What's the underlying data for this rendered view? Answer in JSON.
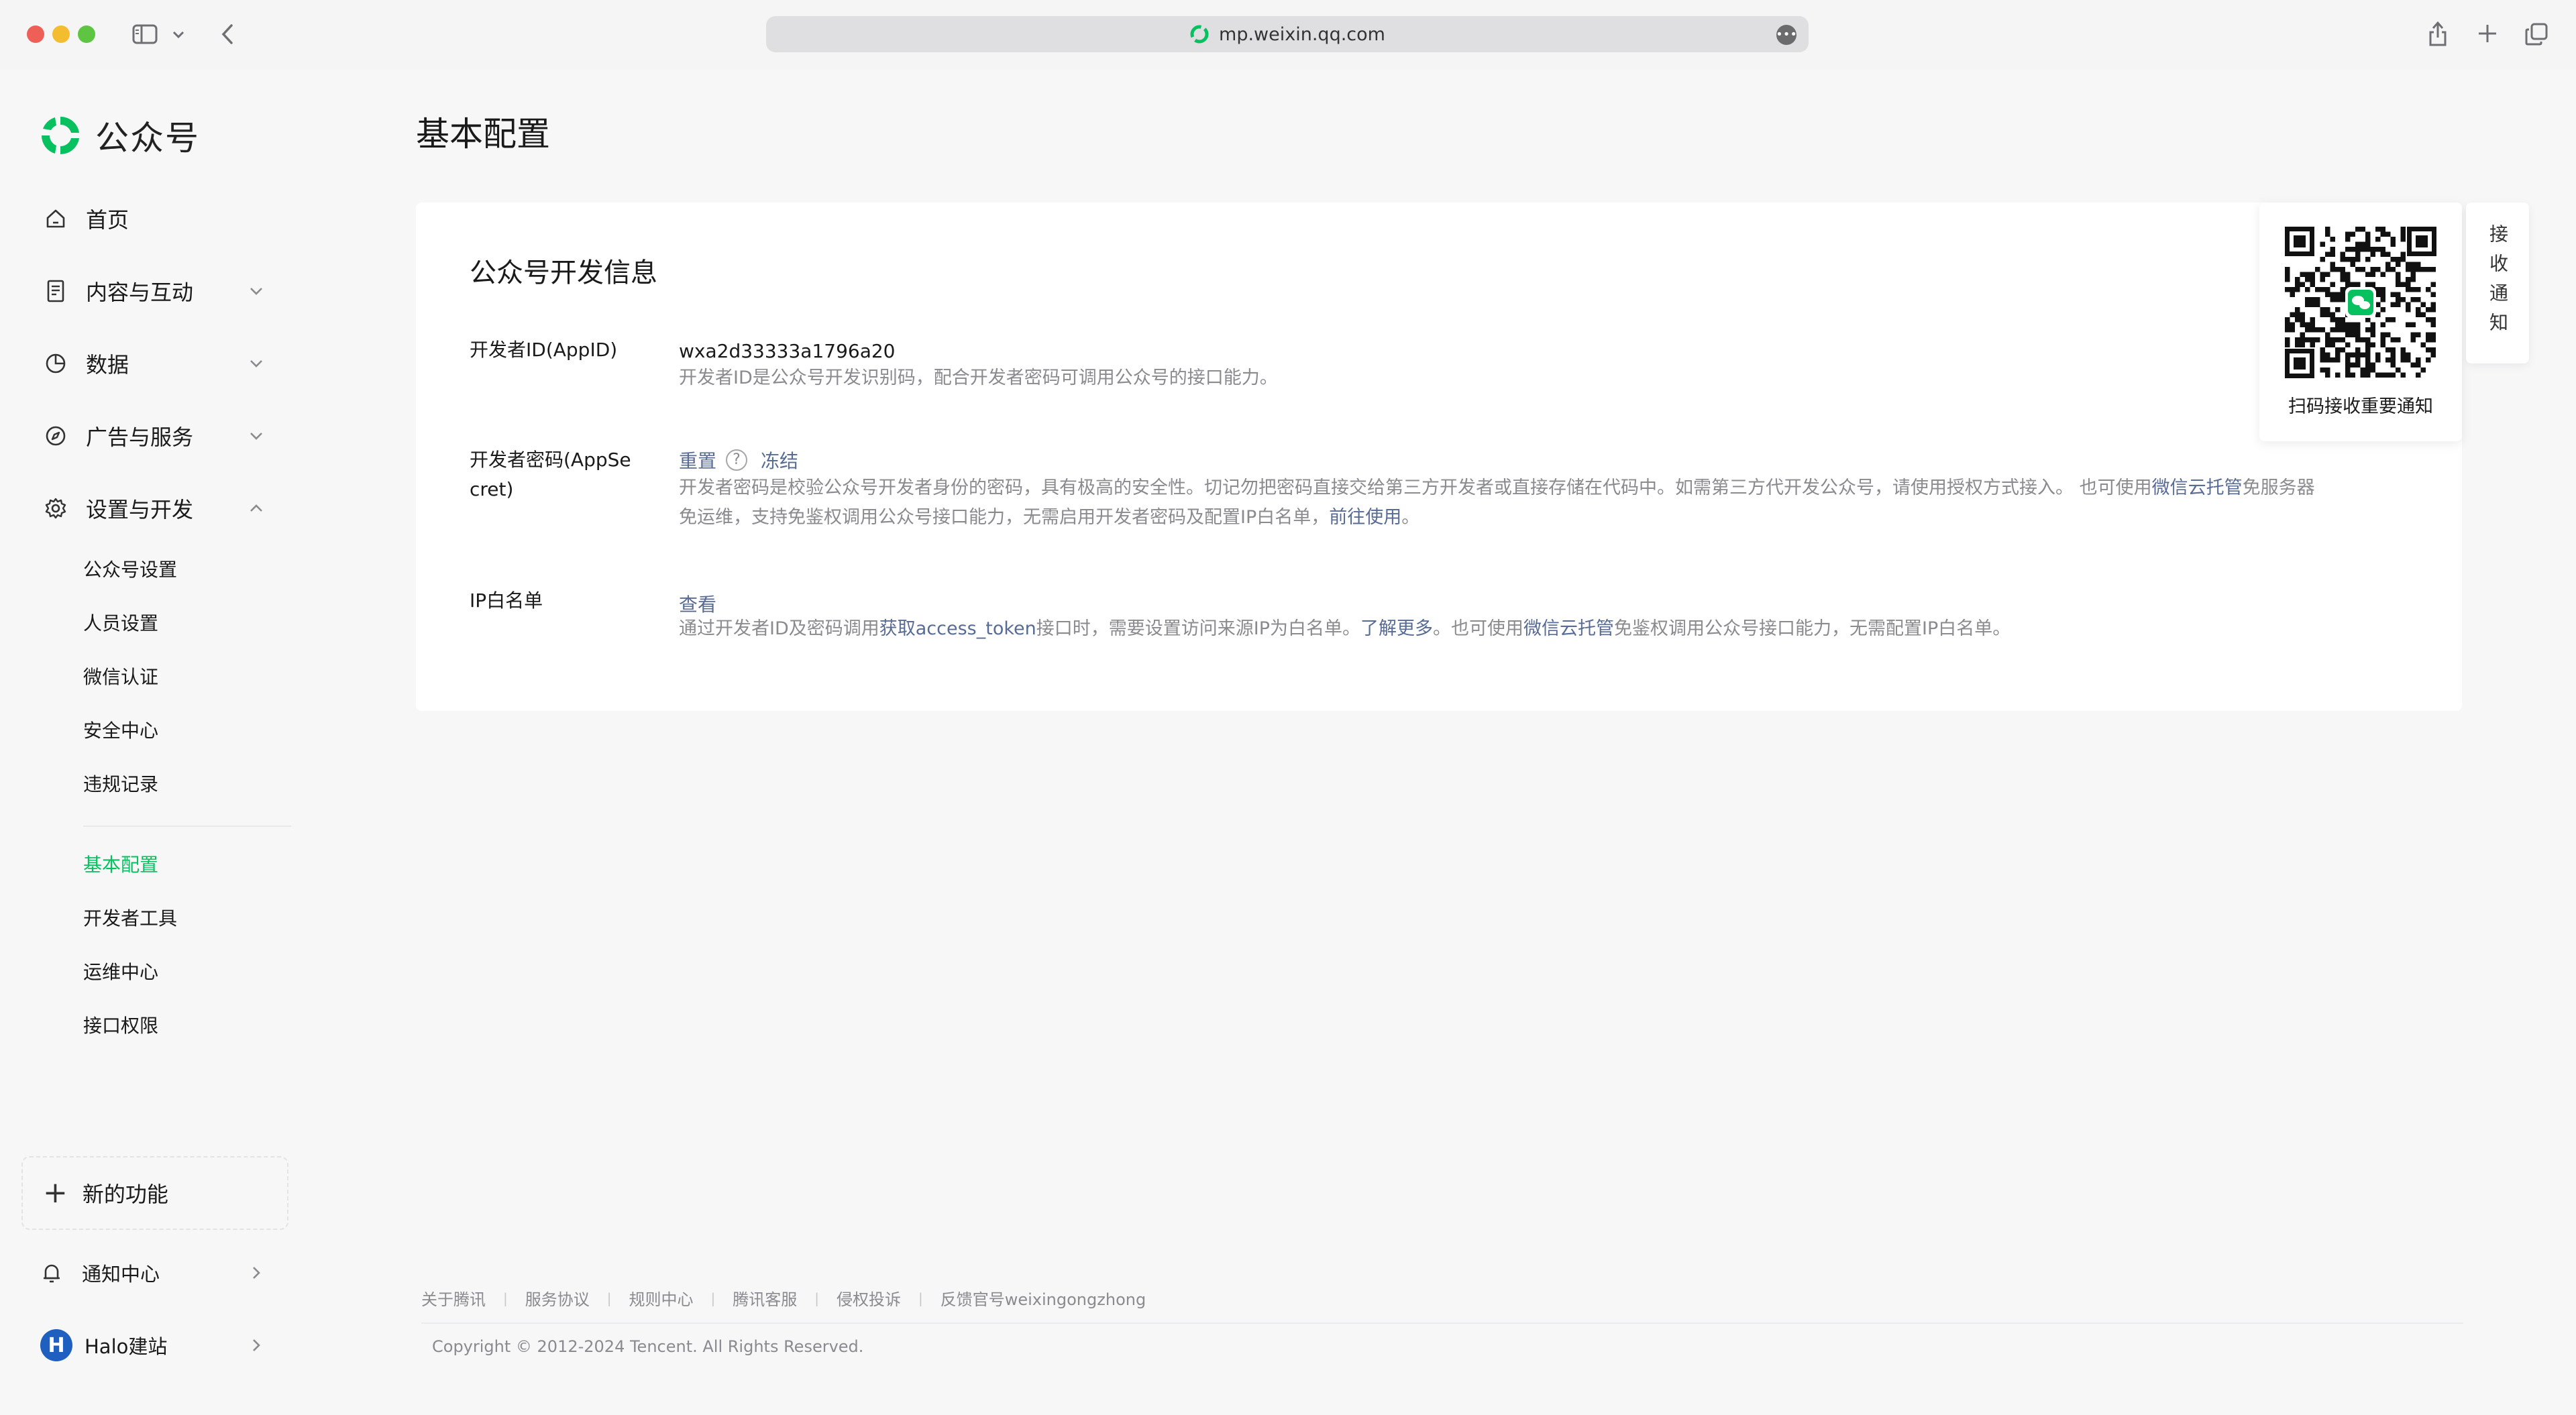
{
  "browser": {
    "url": "mp.weixin.qq.com"
  },
  "sidebar": {
    "logo_text": "公众号",
    "nav": [
      {
        "label": "首页",
        "icon": "home-icon"
      },
      {
        "label": "内容与互动",
        "icon": "document-icon"
      },
      {
        "label": "数据",
        "icon": "chart-pie-icon"
      },
      {
        "label": "广告与服务",
        "icon": "compass-icon"
      },
      {
        "label": "设置与开发",
        "icon": "gear-icon"
      }
    ],
    "settings_items": [
      "公众号设置",
      "人员设置",
      "微信认证",
      "安全中心",
      "违规记录"
    ],
    "dev_items": [
      "基本配置",
      "开发者工具",
      "运维中心",
      "接口权限"
    ],
    "active_item": "基本配置",
    "new_feature": "新的功能",
    "notification_center": "通知中心",
    "account_name": "Halo建站",
    "account_initial": "H"
  },
  "main": {
    "page_title": "基本配置",
    "card_title": "公众号开发信息",
    "appid": {
      "label": "开发者ID(AppID)",
      "value": "wxa2d33333a1796a20",
      "desc": "开发者ID是公众号开发识别码，配合开发者密码可调用公众号的接口能力。"
    },
    "secret": {
      "label_line1": "开发者密码(AppSe",
      "label_line2": "cret)",
      "reset": "重置",
      "freeze": "冻结",
      "desc_1": "开发者密码是校验公众号开发者身份的密码，具有极高的安全性。切记勿把密码直接交给第三方开发者或直接存储在代码中。如需第三方代开发公众号，请使用授权方式接入。 也可使用",
      "desc_link_1": "微信云托管",
      "desc_2": "免服务器",
      "desc_3": "免运维，支持免鉴权调用公众号接口能力，无需启用开发者密码及配置IP白名单，",
      "desc_link_2": "前往使用",
      "desc_4": "。"
    },
    "ip": {
      "label": "IP白名单",
      "view": "查看",
      "desc_1": "通过开发者ID及密码调用",
      "desc_link_1": "获取access_token",
      "desc_2": "接口时，需要设置访问来源IP为白名单。",
      "desc_link_2": "了解更多",
      "desc_3": "。也可使用",
      "desc_link_3": "微信云托管",
      "desc_4": "免鉴权调用公众号接口能力，无需配置IP白名单。"
    }
  },
  "qr": {
    "caption": "扫码接收重要通知",
    "tab_label": "接收通知"
  },
  "footer": {
    "links": [
      "关于腾讯",
      "服务协议",
      "规则中心",
      "腾讯客服",
      "侵权投诉",
      "反馈官号weixingongzhong"
    ],
    "copyright": "Copyright © 2012-2024 Tencent. All Rights Reserved."
  },
  "colors": {
    "accent": "#07c160",
    "link": "#576b95"
  }
}
